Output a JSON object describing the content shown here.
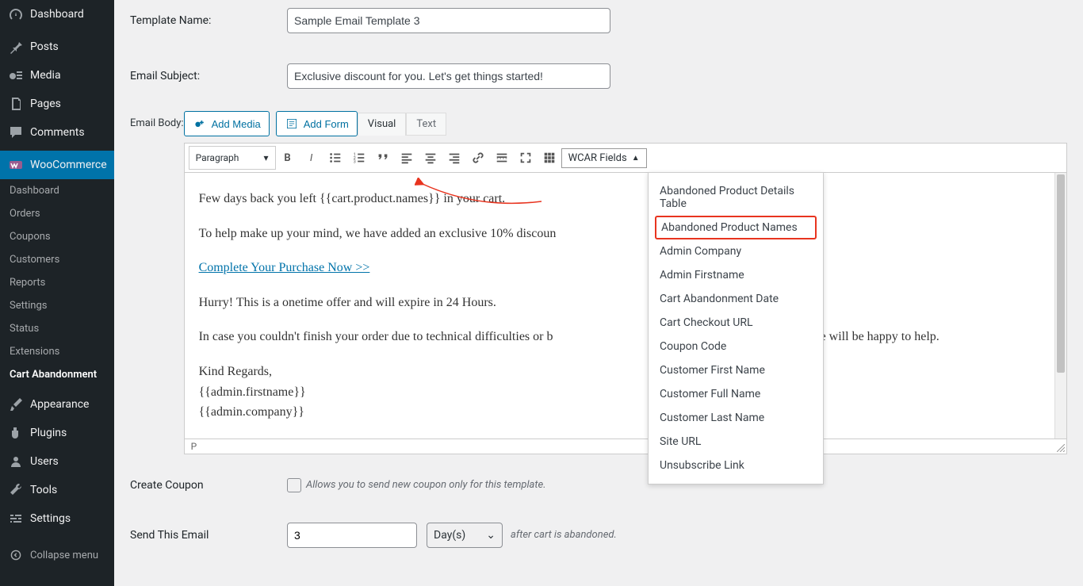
{
  "sidebar": {
    "items": [
      {
        "label": "Dashboard",
        "icon": "gauge-icon"
      },
      {
        "label": "Posts",
        "icon": "pin-icon"
      },
      {
        "label": "Media",
        "icon": "media-icon"
      },
      {
        "label": "Pages",
        "icon": "pages-icon"
      },
      {
        "label": "Comments",
        "icon": "comment-icon"
      },
      {
        "label": "WooCommerce",
        "icon": "woo-icon"
      }
    ],
    "sub": [
      {
        "label": "Dashboard"
      },
      {
        "label": "Orders"
      },
      {
        "label": "Coupons"
      },
      {
        "label": "Customers"
      },
      {
        "label": "Reports"
      },
      {
        "label": "Settings"
      },
      {
        "label": "Status"
      },
      {
        "label": "Extensions"
      },
      {
        "label": "Cart Abandonment"
      }
    ],
    "items2": [
      {
        "label": "Appearance",
        "icon": "brush-icon"
      },
      {
        "label": "Plugins",
        "icon": "plugin-icon"
      },
      {
        "label": "Users",
        "icon": "user-icon"
      },
      {
        "label": "Tools",
        "icon": "wrench-icon"
      },
      {
        "label": "Settings",
        "icon": "sliders-icon"
      }
    ],
    "collapse": "Collapse menu"
  },
  "form": {
    "templateNameLabel": "Template Name:",
    "templateNameValue": "Sample Email Template 3",
    "emailSubjectLabel": "Email Subject:",
    "emailSubjectValue": "Exclusive discount for you. Let's get things started!",
    "emailBodyLabel": "Email Body:",
    "addMedia": "Add Media",
    "addForm": "Add Form",
    "visual": "Visual",
    "text": "Text",
    "paragraph": "Paragraph",
    "wcarLabel": "WCAR Fields",
    "createCouponLabel": "Create Coupon",
    "createCouponHint": "Allows you to send new coupon only for this template.",
    "sendLabel": "Send This Email",
    "sendValue": "3",
    "sendUnit": "Day(s)",
    "sendAfter": "after cart is abandoned.",
    "statusP": "P"
  },
  "dropdown": {
    "0": "Abandoned Product Details Table",
    "1": "Abandoned Product Names",
    "2": "Admin Company",
    "3": "Admin Firstname",
    "4": "Cart Abandonment Date",
    "5": "Cart Checkout URL",
    "6": "Coupon Code",
    "7": "Customer First Name",
    "8": "Customer Full Name",
    "9": "Customer Last Name",
    "10": "Site URL",
    "11": "Unsubscribe Link"
  },
  "body": {
    "p1a": "Few days back you left ",
    "p1b": "{{cart.product.names}}",
    "p1c": " in your cart.",
    "p2": "To help make up your mind, we have added an exclusive 10% discoun",
    "p2b": "your cart.",
    "link": "Complete Your Purchase Now >>",
    "p4": "Hurry! This is a onetime offer and will expire in 24 Hours.",
    "p5a": "In case you couldn't finish your order due to technical difficulties or b",
    "p5b": "ply to this email we will be happy to help.",
    "p6": "Kind Regards,",
    "p7": "{{admin.firstname}}",
    "p8": "{{admin.company}}"
  }
}
